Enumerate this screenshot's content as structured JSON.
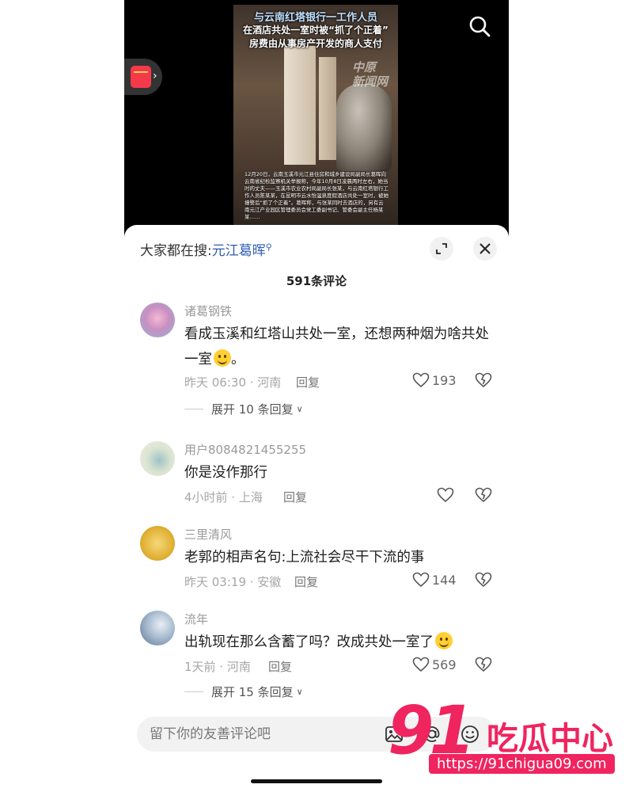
{
  "video": {
    "title_line1": "与云南红塔银行一工作人员",
    "title_line2": "在酒店共处一室时被“抓了个正着”",
    "title_line3": "房费由从事房产开发的商人支付",
    "watermark": "中原\n新闻网",
    "caption": "12月20日，云南玉溪市元江县住房和城乡建设局副局长葛晖向云南省纪检监察机关举报称，今年10月8日凌晨两时左右，她当时的丈夫——玉溪市农业农村局副局长张某，与云南红塔银行工作人员陈某某，在昆明市云水怡温泉度假酒店共处一室时，被她撞警后“抓了个正着”。葛晖称，与张某同时去酒店的，另有云南元江产业园区管理委员会党工委副书记、管委会副主任杨某某……"
  },
  "sheet": {
    "search_prefix": "大家都在搜:",
    "search_keyword": "元江葛晖",
    "comment_count": "591条评论"
  },
  "comments": [
    {
      "user": "诸葛钢铁",
      "text": "看成玉溪和红塔山共处一室，还想两种烟为啥共处一室",
      "text_tail": "。",
      "meta": "昨天 06:30 · 河南",
      "reply": "回复",
      "likes": "193",
      "expand": "展开 10 条回复"
    },
    {
      "user": "用户8084821455255",
      "text": "你是没作那行",
      "meta": "4小时前 · 上海",
      "reply": "回复",
      "likes": ""
    },
    {
      "user": "三里清风",
      "text": "老郭的相声名句:上流社会尽干下流的事",
      "meta": "昨天 03:19 · 安徽",
      "reply": "回复",
      "likes": "144"
    },
    {
      "user": "流年",
      "text": "出轨现在那么含蓄了吗？改成共处一室了",
      "meta": "1天前 · 河南",
      "reply": "回复",
      "likes": "569",
      "expand": "展开 15 条回复"
    }
  ],
  "input": {
    "placeholder": "留下你的友善评论吧"
  },
  "overlay": {
    "logo_number": "91",
    "logo_text": "吃瓜中心",
    "logo_url": "https://91chigua09.com"
  },
  "colors": {
    "accent": "#f0245f",
    "keyword": "#2e5bb5"
  }
}
